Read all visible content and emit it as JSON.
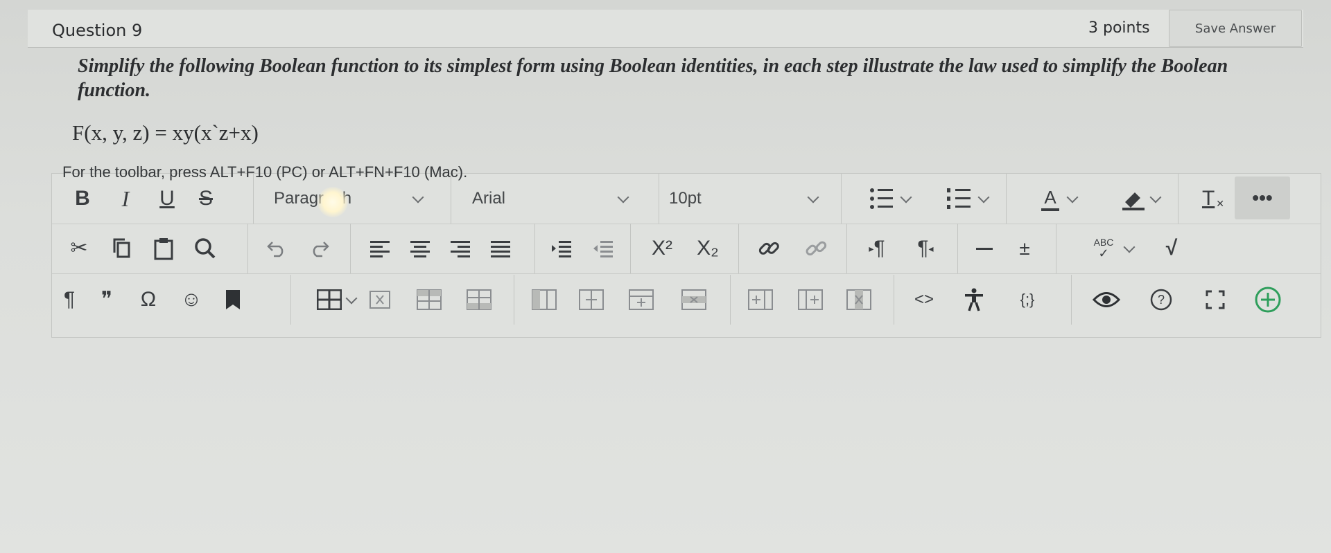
{
  "question": {
    "title": "Question 9",
    "points": "3 points",
    "save_label": "Save Answer",
    "text": "Simplify the following Boolean function to its simplest form using Boolean identities, in each step illustrate the law used to simplify the Boolean function.",
    "function": "F(x, y, z) = xy(x`z+x)"
  },
  "editor": {
    "toolbar_hint": "For the toolbar, press ALT+F10 (PC) or ALT+FN+F10 (Mac).",
    "row1": {
      "bold": "B",
      "italic": "I",
      "underline": "U",
      "strike": "S",
      "paragraph_dropdown": "Paragraph",
      "font_dropdown": "Arial",
      "size_dropdown": "10pt",
      "text_color_letter": "A",
      "clear_format": "T"
    },
    "row2": {
      "superscript": "X²",
      "subscript": "X₂",
      "ltr": "¶",
      "rtl": "¶",
      "spellcheck_label": "ABC"
    },
    "row3": {
      "paragraph_mark": "¶",
      "quote": "❞",
      "omega": "Ω",
      "code": "<>",
      "code_block": "{;}"
    }
  },
  "colors": {
    "accent_green": "#2e9e5b",
    "icon_gray": "#3a3d40"
  }
}
